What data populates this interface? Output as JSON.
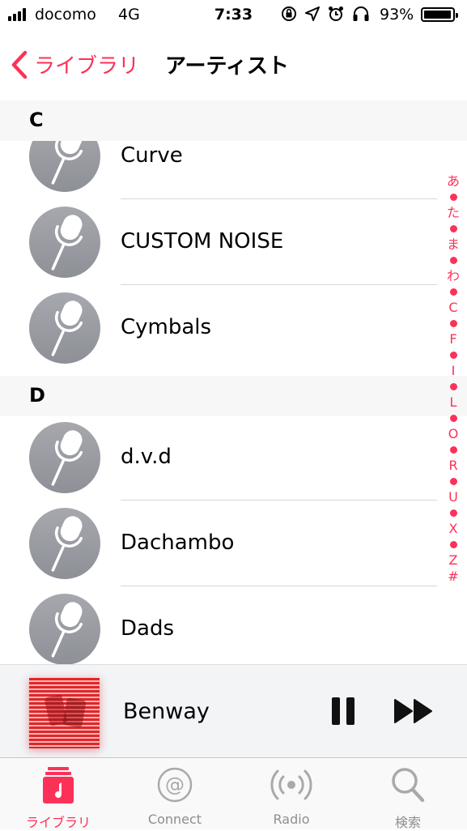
{
  "status_bar": {
    "carrier": "docomo",
    "network": "4G",
    "time": "7:33",
    "battery": "93%",
    "battery_level": 0.93
  },
  "nav": {
    "back_label": "ライブラリ",
    "title": "アーティスト"
  },
  "sections": [
    {
      "letter": "C",
      "artists": [
        "Curve",
        "CUSTOM NOISE",
        "Cymbals"
      ]
    },
    {
      "letter": "D",
      "artists": [
        "d.v.d",
        "Dachambo",
        "Dads"
      ]
    }
  ],
  "index": [
    "あ",
    "た",
    "ま",
    "わ",
    "C",
    "F",
    "I",
    "L",
    "O",
    "R",
    "U",
    "X",
    "Z",
    "#"
  ],
  "now_playing": {
    "title": "Benway"
  },
  "tabs": [
    {
      "label": "ライブラリ",
      "icon": "music-note-icon",
      "active": true
    },
    {
      "label": "Connect",
      "icon": "at-sign-icon",
      "active": false
    },
    {
      "label": "Radio",
      "icon": "radio-broadcast-icon",
      "active": false
    },
    {
      "label": "検索",
      "icon": "search-icon",
      "active": false
    }
  ],
  "colors": {
    "accent": "#fc3158",
    "inactive": "#8e8e93",
    "avatar": "#9a9ca2"
  }
}
